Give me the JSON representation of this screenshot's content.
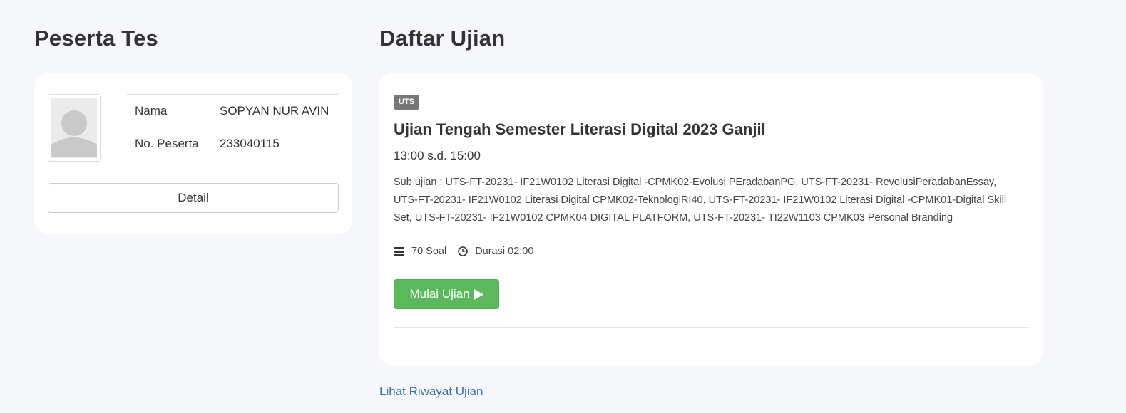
{
  "participant_section": {
    "title": "Peserta Tes",
    "rows": [
      {
        "label": "Nama",
        "value": "SOPYAN NUR AVIN"
      },
      {
        "label": "No. Peserta",
        "value": "233040115"
      }
    ],
    "detail_label": "Detail"
  },
  "exam_section": {
    "title": "Daftar Ujian",
    "exam": {
      "badge": "UTS",
      "title": "Ujian Tengah Semester Literasi Digital 2023 Ganjil",
      "time": "13:00 s.d. 15:00",
      "sub_exam": "Sub ujian : UTS-FT-20231- IF21W0102 Literasi Digital -CPMK02-Evolusi PEradabanPG, UTS-FT-20231- RevolusiPeradabanEssay, UTS-FT-20231- IF21W0102 Literasi Digital CPMK02-TeknologiRI40, UTS-FT-20231- IF21W0102 Literasi Digital -CPMK01-Digital Skill Set, UTS-FT-20231- IF21W0102 CPMK04 DIGITAL PLATFORM, UTS-FT-20231- TI22W1103 CPMK03 Personal Branding",
      "question_count": "70 Soal",
      "duration": "Durasi 02:00",
      "start_label": "Mulai Ujian"
    },
    "history_link": "Lihat Riwayat Ujian"
  },
  "colors": {
    "background": "#f5f7fa",
    "card": "#ffffff",
    "badge": "#777777",
    "start_button": "#5cb85c",
    "link": "#3a6ea5"
  },
  "icons": {
    "avatar": "default-user-avatar",
    "questions": "list-icon",
    "duration": "clock-icon",
    "start": "play-icon"
  }
}
